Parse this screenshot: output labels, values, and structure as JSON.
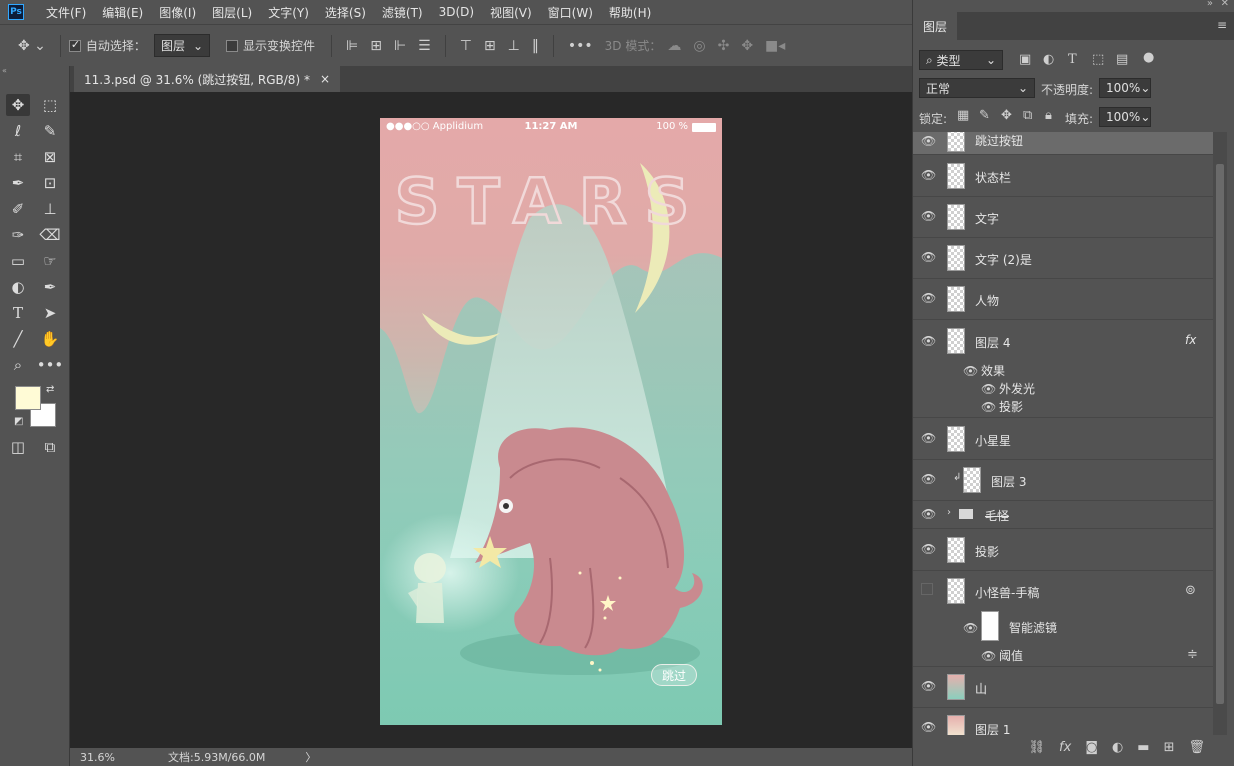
{
  "app": {
    "logo": "Ps",
    "menu": [
      "文件(F)",
      "编辑(E)",
      "图像(I)",
      "图层(L)",
      "文字(Y)",
      "选择(S)",
      "滤镜(T)",
      "3D(D)",
      "视图(V)",
      "窗口(W)",
      "帮助(H)"
    ]
  },
  "options": {
    "auto_select_label": "自动选择：",
    "auto_select_checked": true,
    "auto_select_target": "图层",
    "show_transform_label": "显示变换控件",
    "show_transform_checked": false,
    "mode_3d_label": "3D 模式："
  },
  "document": {
    "tab_title": "11.3.psd @ 31.6% (跳过按钮, RGB/8) *",
    "tab_close": "×",
    "zoom": "31.6%",
    "doc_size": "文档:5.93M/66.0M",
    "status_arrow": "〉"
  },
  "artwork": {
    "carrier": "●●●○○ Applidium",
    "time": "11:27 AM",
    "battery": "100 %",
    "headline": "STARS",
    "skip_button": "跳过"
  },
  "layers_panel": {
    "title": "图层",
    "filter_label": "类型",
    "blend_mode": "正常",
    "opacity_label": "不透明度:",
    "opacity_value": "100%",
    "lock_label": "锁定:",
    "fill_label": "填充:",
    "fill_value": "100%",
    "layers": [
      {
        "name": "跳过按钮",
        "visible": true,
        "selected": true
      },
      {
        "name": "状态栏",
        "visible": true
      },
      {
        "name": "文字",
        "visible": true
      },
      {
        "name": "文字 (2)是",
        "visible": true
      },
      {
        "name": "人物",
        "visible": true
      },
      {
        "name": "图层 4",
        "visible": true,
        "fx": "fx"
      },
      {
        "name": "效果",
        "visible": true
      },
      {
        "name": "外发光",
        "visible": true
      },
      {
        "name": "投影",
        "visible": true
      },
      {
        "name": "小星星",
        "visible": true
      },
      {
        "name": "图层 3",
        "visible": true
      },
      {
        "name": "毛怪",
        "visible": true
      },
      {
        "name": "投影",
        "visible": true
      },
      {
        "name": "小怪兽-手稿",
        "visible": false
      },
      {
        "name": "智能滤镜",
        "visible": true
      },
      {
        "name": "阈值",
        "visible": true
      },
      {
        "name": "山",
        "visible": true
      },
      {
        "name": "图层 1",
        "visible": true
      }
    ]
  },
  "colors": {
    "foreground": "#fffbd6",
    "background": "#ffffff",
    "accent": "#31a8ff"
  }
}
